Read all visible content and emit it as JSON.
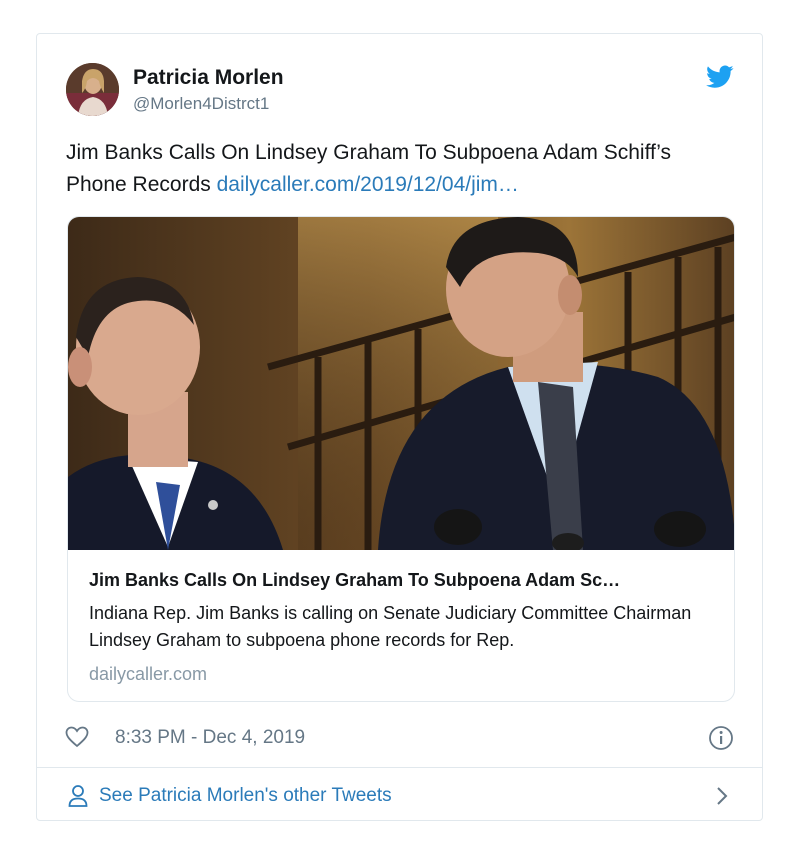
{
  "author": {
    "display_name": "Patricia Morlen",
    "username": "@Morlen4Distrct1"
  },
  "tweet": {
    "text": "Jim Banks Calls On Lindsey Graham To Subpoena Adam Schiff’s Phone Records",
    "link_text": "dailycaller.com/2019/12/04/jim…"
  },
  "link_card": {
    "title": "Jim Banks Calls On Lindsey Graham To Subpoena Adam Sc…",
    "description": "Indiana Rep. Jim Banks is calling on Senate Judiciary Committee Chairman Lindsey Graham to subpoena phone records for Rep.",
    "domain": "dailycaller.com"
  },
  "meta": {
    "timestamp": "8:33 PM - Dec 4, 2019"
  },
  "footer": {
    "label": "See Patricia Morlen's other Tweets"
  },
  "icons": {
    "brand": "twitter-bird-icon",
    "like": "heart-icon",
    "info": "info-icon",
    "profile": "person-icon",
    "more": "chevron-right-icon"
  },
  "colors": {
    "twitter_blue": "#1da1f2",
    "link_blue": "#2b7bb9",
    "secondary_text": "#657786",
    "border": "#e1e8ed"
  }
}
